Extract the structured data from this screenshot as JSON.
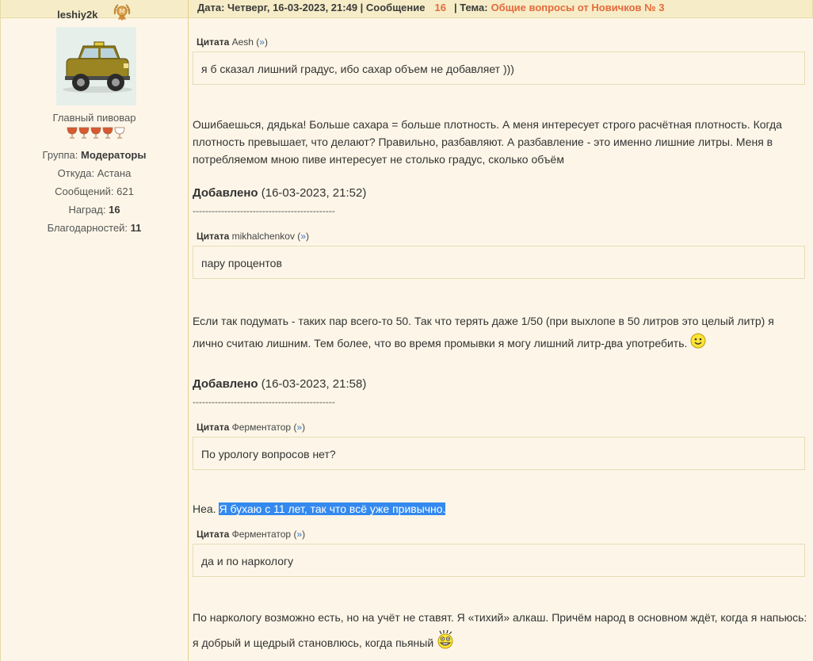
{
  "header": {
    "username": "leshiy2k",
    "info_prefix": "Дата: Четверг, 16-03-2023, 21:49 | Сообщение",
    "message_number": "16",
    "topic_label": "| Тема:",
    "topic_title": "Общие вопросы от Новичков № 3"
  },
  "profile": {
    "rank": "Главный пивовар",
    "group_label": "Группа:",
    "group_value": "Модераторы",
    "from_label": "Откуда:",
    "from_value": "Астана",
    "messages_label": "Сообщений:",
    "messages_value": "621",
    "awards_label": "Наград:",
    "awards_value": "16",
    "thanks_label": "Благодарностей:",
    "thanks_value": "11"
  },
  "quote_word": "Цитата",
  "quote_link": "»",
  "post": {
    "q1_author": "Aesh",
    "q1_text": "я б сказал лишний градус, ибо сахар объем не добавляет )))",
    "p1": "Ошибаешься, дядька! Больше сахара = больше плотность. А меня интересует строго расчётная плотность. Когда плотность превышает, что делают? Правильно, разбавляют. А разбавление - это именно лишние литры. Меня в потребляемом мною пиве интересует не столько градус, сколько объём",
    "added_label": "Добавлено",
    "added1_time": "(16-03-2023, 21:52)",
    "dashes": "---------------------------------------------",
    "q2_author": "mikhalchenkov",
    "q2_text": "пару процентов",
    "p2": "Если так подумать - таких пар всего-то 50. Так что терять даже 1/50 (при выхлопе в 50 литров это целый литр) я лично считаю лишним. Тем более, что во время промывки я могу лишний литр-два употребить.",
    "added2_time": "(16-03-2023, 21:58)",
    "q3_author": "Ферментатор",
    "q3_text": "По урологу вопросов нет?",
    "p3_plain": "Неа.",
    "p3_highlight": "Я бухаю с 11 лет, так что всё уже привычно.",
    "q4_author": "Ферментатор",
    "q4_text": "да и по наркологу",
    "p4": "По наркологу возможно есть, но на учёт не ставят. Я «тихий» алкаш. Причём народ в основном ждёт, когда я напьюсь: я добрый и щедрый становлюсь, когда пьяный"
  },
  "icons": {
    "medal": "medal-icon",
    "avatar": "jeep-avatar",
    "rating": "beer-glass-icon",
    "smile": "smile-icon",
    "grin": "crazy-grin-icon"
  },
  "rating_glasses_filled": 4,
  "rating_glasses_total": 5
}
